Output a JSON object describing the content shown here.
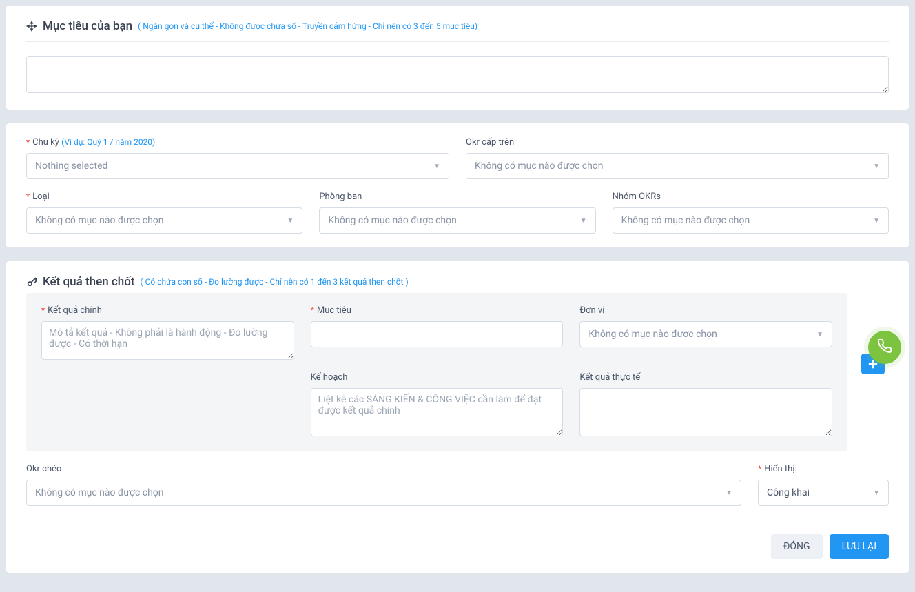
{
  "objective": {
    "title": "Mục tiêu của bạn",
    "hint": "( Ngắn gọn và cụ thể - Không được chứa số - Truyền cảm hứng - Chỉ nên có 3 đến 5 mục tiêu)"
  },
  "fields": {
    "cycle": {
      "label": "Chu kỳ",
      "hint": "(Ví dụ: Quý 1 / năm 2020)",
      "value": "Nothing selected"
    },
    "parent_okr": {
      "label": "Okr cấp trên",
      "value": "Không có mục nào được chọn"
    },
    "type": {
      "label": "Loại",
      "value": "Không có mục nào được chọn"
    },
    "department": {
      "label": "Phòng ban",
      "value": "Không có mục nào được chọn"
    },
    "okr_group": {
      "label": "Nhóm OKRs",
      "value": "Không có mục nào được chọn"
    }
  },
  "key_results": {
    "title": "Kết quả then chốt",
    "hint": "( Có chứa con số - Đo lường được - Chỉ nên có 1 đến 3 kết quả then chốt )",
    "kr_label": "Kết quả chính",
    "kr_placeholder": "Mô tả kết quả - Không phải là hành động - Đo lường được - Có thời hạn",
    "target_label": "Mục tiêu",
    "unit_label": "Đơn vị",
    "unit_value": "Không có mục nào được chọn",
    "plan_label": "Kế hoạch",
    "plan_placeholder": "Liệt kê các SÁNG KIẾN & CÔNG VIỆC cần làm để đạt được kết quả chính",
    "actual_label": "Kết quả thực tế"
  },
  "cross_okr": {
    "label": "Okr chéo",
    "value": "Không có mục nào được chọn"
  },
  "visibility": {
    "label": "Hiển thị:",
    "value": "Công khai"
  },
  "buttons": {
    "close": "ĐÓNG",
    "save": "LƯU LẠI"
  }
}
